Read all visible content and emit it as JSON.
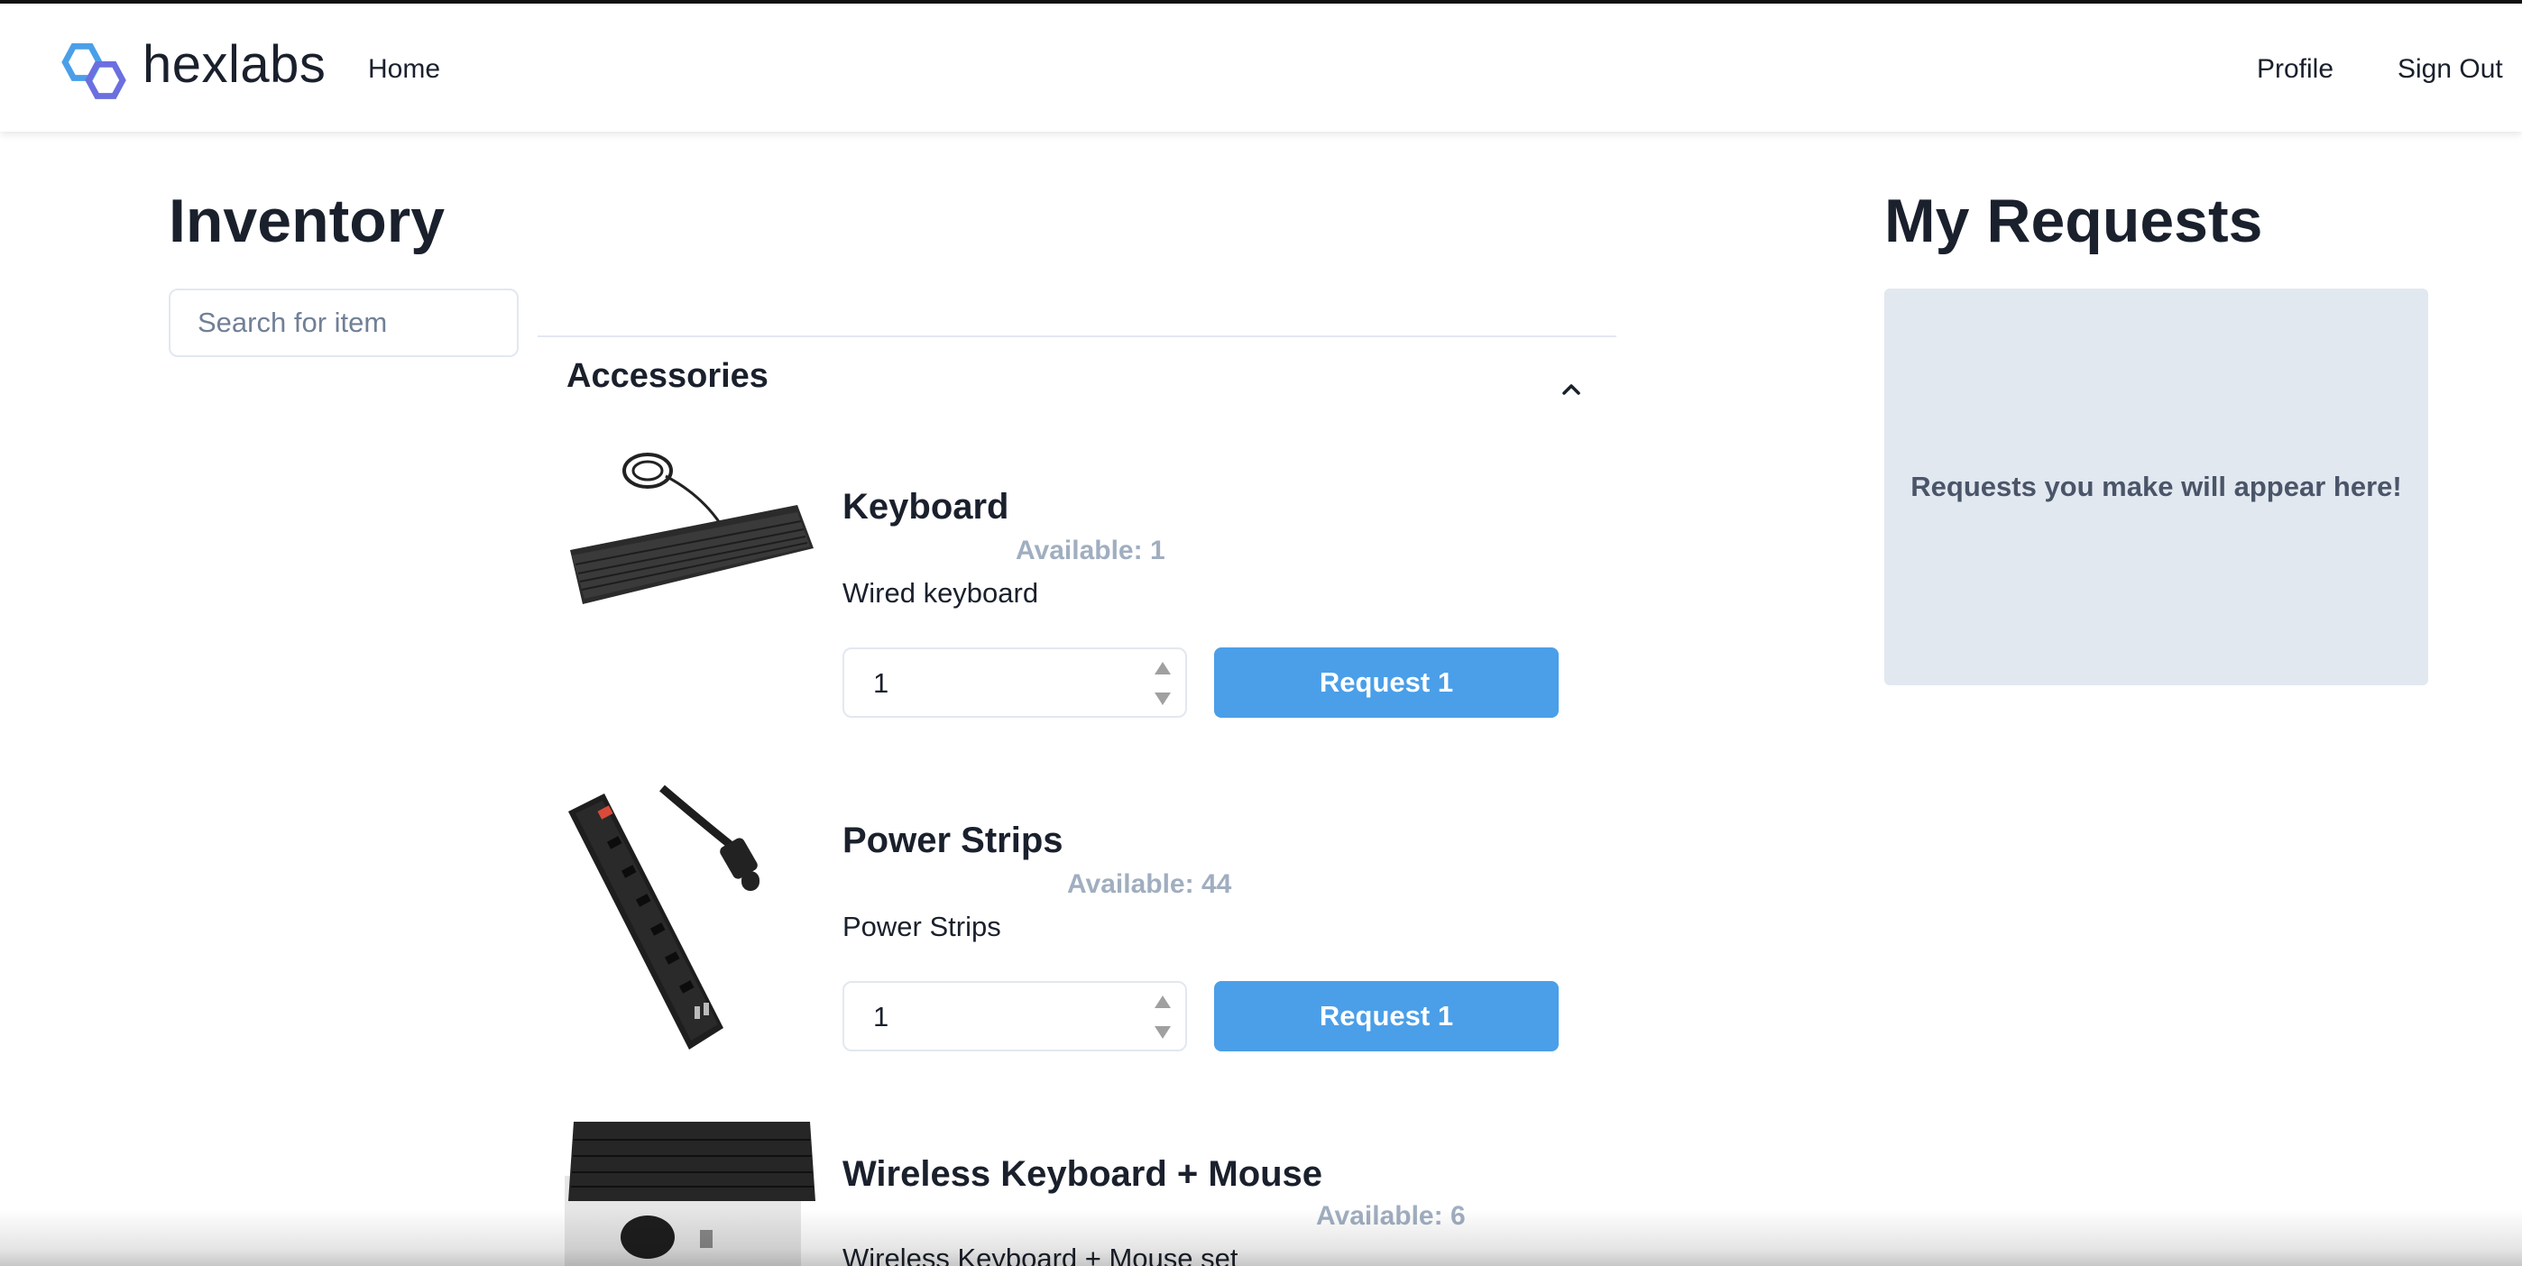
{
  "navbar": {
    "brand": "hexlabs",
    "home_label": "Home",
    "profile_label": "Profile",
    "signout_label": "Sign Out",
    "logo_colors": [
      "#4a9fe8",
      "#6b6fe0"
    ]
  },
  "inventory": {
    "title": "Inventory",
    "search_placeholder": "Search for item",
    "category": {
      "name": "Accessories",
      "expanded": true,
      "items": [
        {
          "name": "Keyboard",
          "available": "Available: 1",
          "description": "Wired keyboard",
          "quantity": "1",
          "button_label": "Request 1",
          "image": "keyboard-image"
        },
        {
          "name": "Power Strips",
          "available": "Available: 44",
          "description": "Power Strips",
          "quantity": "1",
          "button_label": "Request 1",
          "image": "power-strip-image"
        },
        {
          "name": "Wireless Keyboard + Mouse",
          "available": "Available: 6",
          "description": "Wireless Keyboard + Mouse set",
          "image": "wireless-keyboard-mouse-image"
        }
      ]
    }
  },
  "requests": {
    "title": "My Requests",
    "empty_message": "Requests you make will appear here!"
  },
  "colors": {
    "accent": "#4a9fe8",
    "available_text": "#a0aec0",
    "panel_bg": "#e2e8f0"
  }
}
